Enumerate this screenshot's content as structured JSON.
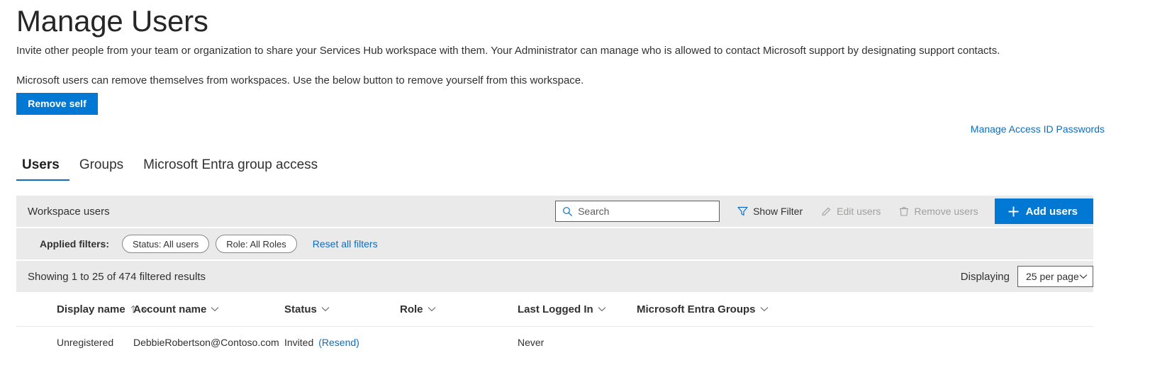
{
  "header": {
    "title": "Manage Users",
    "intro_line_1": "Invite other people from your team or organization to share your Services Hub workspace with them. Your Administrator can manage who is allowed to contact Microsoft support by designating support contacts.",
    "intro_line_2": "Microsoft users can remove themselves from workspaces. Use the below button to remove yourself from this workspace.",
    "remove_self_label": "Remove self",
    "manage_access_link": "Manage Access ID Passwords"
  },
  "tabs": [
    {
      "label": "Users",
      "active": true
    },
    {
      "label": "Groups",
      "active": false
    },
    {
      "label": "Microsoft Entra group access",
      "active": false
    }
  ],
  "toolbar": {
    "section_label": "Workspace users",
    "search_placeholder": "Search",
    "search_value": "",
    "show_filter_label": "Show Filter",
    "edit_users_label": "Edit users",
    "remove_users_label": "Remove users",
    "add_users_label": "Add users"
  },
  "filters": {
    "applied_label": "Applied filters:",
    "chips": [
      "Status: All users",
      "Role: All Roles"
    ],
    "reset_label": "Reset all filters"
  },
  "results": {
    "showing_text": "Showing 1 to 25 of 474 filtered results",
    "displaying_label": "Displaying",
    "page_size_value": "25 per page"
  },
  "table": {
    "columns": [
      {
        "label": "Display name",
        "sorted": "asc"
      },
      {
        "label": "Account name",
        "sorted": ""
      },
      {
        "label": "Status",
        "sorted": ""
      },
      {
        "label": "Role",
        "sorted": ""
      },
      {
        "label": "Last Logged In",
        "sorted": ""
      },
      {
        "label": "Microsoft Entra Groups",
        "sorted": ""
      }
    ],
    "rows": [
      {
        "display_name": "Unregistered",
        "account_name": "DebbieRobertson@Contoso.com",
        "status": "Invited",
        "status_action": "(Resend)",
        "role": "",
        "last_logged_in": "Never",
        "entra_groups": ""
      }
    ]
  },
  "colors": {
    "accent": "#0078d4",
    "link": "#0f6cbd",
    "band": "#ebeaea",
    "text": "#323130"
  },
  "icons": {
    "search": "search-icon",
    "filter": "filter-icon",
    "edit": "pencil-icon",
    "remove": "trash-icon",
    "add": "plus-icon",
    "chevron": "chevron-down-icon",
    "sort_asc": "arrow-up-icon"
  }
}
